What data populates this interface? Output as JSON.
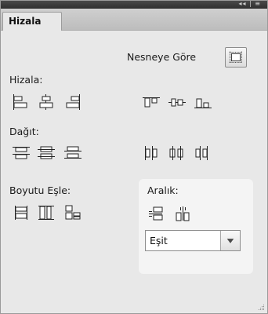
{
  "window": {
    "controls_label": "◂◂ | ≡"
  },
  "tabs": [
    {
      "label": "Hizala",
      "active": true
    }
  ],
  "relative_to": {
    "label": "Nesneye Göre",
    "icon": "align-to-selection-icon"
  },
  "sections": {
    "align": {
      "title": "Hizala:"
    },
    "distribute": {
      "title": "Dağıt:"
    },
    "match_size": {
      "title": "Boyutu Eşle:"
    },
    "spacing": {
      "title": "Aralık:"
    }
  },
  "spacing_select": {
    "value": "Eşit",
    "icon": "chevron-down-icon"
  },
  "colors": {
    "panel_bg": "#e8e8e8",
    "tabbar_bg": "#c6c6c6",
    "titlebar_bg": "#3a3a3a",
    "spacing_box_bg": "#f4f4f4"
  }
}
